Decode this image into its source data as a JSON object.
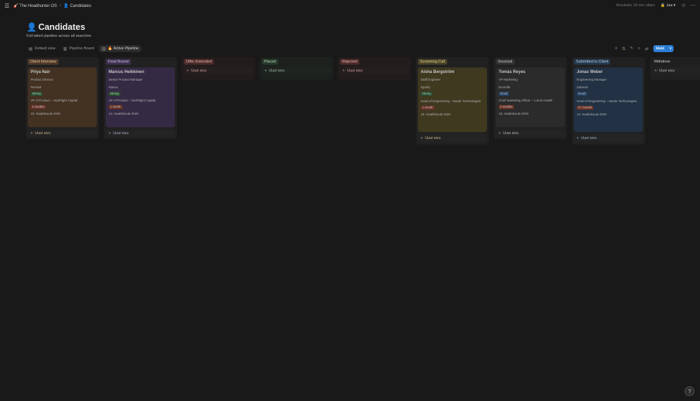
{
  "topbar": {
    "breadcrumb_1": "🎸 The Headhunter OS",
    "breadcrumb_2": "👤 Candidates",
    "edited": "Muokattu 18 min sitten",
    "share": "Jaa"
  },
  "page": {
    "emoji": "👤",
    "title": "Candidates",
    "description": "Full talent pipeline across all searches"
  },
  "views": [
    {
      "label": "Default view",
      "icon": "table-icon"
    },
    {
      "label": "Pipeline Board",
      "icon": "board-icon"
    },
    {
      "label": "🔥 Active Pipeline",
      "icon": "board-icon"
    }
  ],
  "toolbar": {
    "new_label": "Uusi"
  },
  "add_label": "Uusi sivu",
  "columns": [
    {
      "name": "Client Interview",
      "color": "#4f3a28",
      "text": "#e9c6a4",
      "card": {
        "name": "Priya Nair",
        "role": "Product Director",
        "company": "Revolut",
        "fit": "Strong",
        "search": "VP of Product – Northlight Capital",
        "time": "2 months",
        "date": "10. maaliskuuta 2026"
      }
    },
    {
      "name": "Final Round",
      "color": "#3e3150",
      "text": "#cfbde6",
      "card": {
        "name": "Marcus Heikkinen",
        "role": "Senior Product Manager",
        "company": "Klarna",
        "fit": "Strong",
        "search": "VP of Product – Northlight Capital",
        "time": "1 month",
        "date": "14. maaliskuuta 2026"
      }
    },
    {
      "name": "Offer Extended",
      "color": "#4c2c2b",
      "text": "#e8b5b0"
    },
    {
      "name": "Placed",
      "color": "#293a2c",
      "text": "#b7d8b8"
    },
    {
      "name": "Rejected",
      "color": "#4c2c2b",
      "text": "#e8b5b0"
    },
    {
      "name": "Screening Call",
      "color": "#4a4326",
      "text": "#e6d6a0",
      "card": {
        "name": "Aisha Bergström",
        "role": "Staff Engineer",
        "company": "Spotify",
        "fit": "Strong",
        "search": "Head of Engineering – Stackr Technologies",
        "time": "1 month",
        "date": "15. maaliskuuta 2026"
      }
    },
    {
      "name": "Sourced",
      "color": "#323232",
      "text": "#cfcfcf",
      "card": {
        "name": "Tomás Reyes",
        "role": "VP Marketing",
        "company": "Doctolib",
        "fit": "Good",
        "search": "Chief Marketing Officer – Lumis Health",
        "time": "2 months",
        "date": "16. maaliskuuta 2026"
      }
    },
    {
      "name": "Submitted to Client",
      "color": "#283a4f",
      "text": "#b4cfea",
      "card": {
        "name": "Jonas Weber",
        "role": "Engineering Manager",
        "company": "Zalando",
        "fit": "Good",
        "search": "Head of Engineering – Stackr Technologies",
        "time": "3+ months",
        "date": "12. maaliskuuta 2026"
      }
    },
    {
      "name": "Withdrew",
      "color": "#262626",
      "text": "#cfcfcf"
    }
  ],
  "colors": {
    "fit_strong": "#2b5b34",
    "fit_good": "#2c4d72",
    "time_badge": "#7a3b2d",
    "accent": "#2e80d6"
  }
}
